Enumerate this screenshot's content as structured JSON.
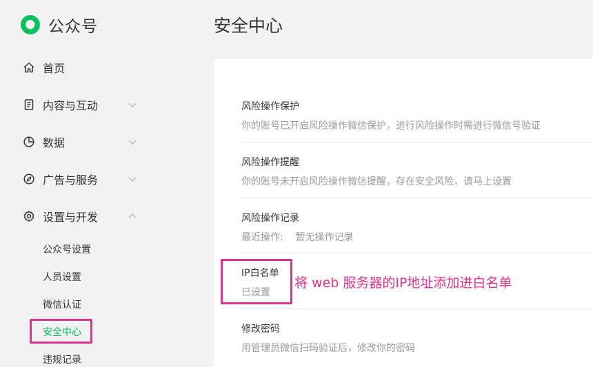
{
  "app": {
    "name": "公众号"
  },
  "page": {
    "title": "安全中心"
  },
  "nav": [
    {
      "label": "首页"
    },
    {
      "label": "内容与互动"
    },
    {
      "label": "数据"
    },
    {
      "label": "广告与服务"
    },
    {
      "label": "设置与开发"
    }
  ],
  "subnav": [
    {
      "label": "公众号设置"
    },
    {
      "label": "人员设置"
    },
    {
      "label": "微信认证"
    },
    {
      "label": "安全中心"
    },
    {
      "label": "违规记录"
    }
  ],
  "security": [
    {
      "title": "风险操作保护",
      "desc": "你的账号已开启风险操作微信保护，进行风险操作时需进行微信号验证"
    },
    {
      "title": "风险操作提醒",
      "desc": "你的账号未开启风险操作微信提醒，存在安全风险，请马上设置"
    },
    {
      "title": "风险操作记录",
      "desc": "最近操作:    暂无操作记录"
    },
    {
      "title": "IP白名单",
      "desc": "已设置"
    },
    {
      "title": "修改密码",
      "desc": "用管理员微信扫码验证后，修改你的密码"
    }
  ],
  "annotation": {
    "text": "将 web 服务器的IP地址添加进白名单"
  },
  "colors": {
    "accent": "#07c160",
    "highlight": "#e0308e",
    "muted": "#9a9a9a"
  }
}
